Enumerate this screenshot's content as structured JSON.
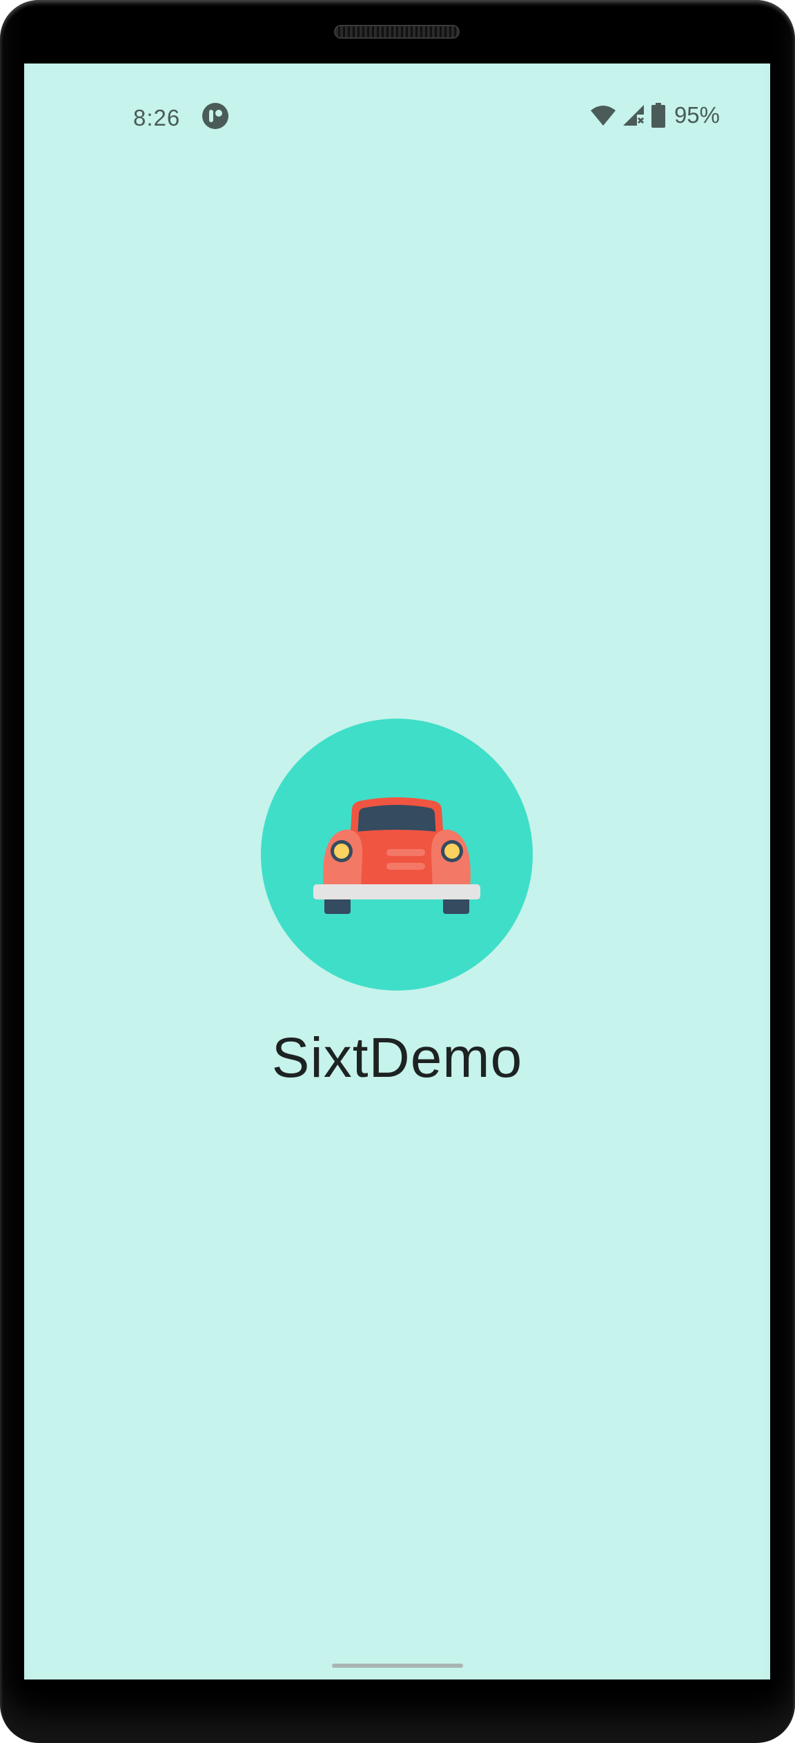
{
  "status_bar": {
    "time": "8:26",
    "app_icon": "app-notification-icon",
    "wifi_icon": "wifi-icon",
    "signal_icon": "cell-signal-no-service-icon",
    "battery_icon": "battery-icon",
    "battery_percent": "95%"
  },
  "splash": {
    "logo_icon": "car-icon",
    "app_name": "SixtDemo"
  },
  "colors": {
    "screen_background": "#c6f3eb",
    "logo_circle": "#3fdec8",
    "car_body": "#f05542",
    "car_window": "#344b60",
    "headlight": "#fbd160",
    "bumper": "#e4e4e4",
    "status_text": "#4a5b58",
    "title_text": "#1d2322"
  }
}
